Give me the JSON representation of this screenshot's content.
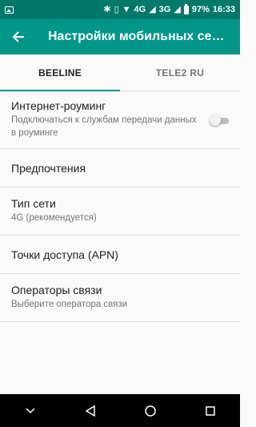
{
  "status_bar": {
    "left_icon": "image-notification-icon",
    "icons": [
      "bluetooth-icon",
      "vibrate-icon",
      "wifi-icon"
    ],
    "network1": "4G",
    "network2": "3G",
    "battery_text": "97%",
    "time": "16:33"
  },
  "app_bar": {
    "back_icon": "arrow-back-icon",
    "title": "Настройки мобильных се…"
  },
  "tabs": [
    {
      "label": "BEELINE",
      "active": true
    },
    {
      "label": "TELE2 RU",
      "active": false
    }
  ],
  "settings": [
    {
      "title": "Интернет-роуминг",
      "summary": "Подключаться к службам передачи данных в роуминге",
      "toggle": false
    },
    {
      "title": "Предпочтения",
      "summary": ""
    },
    {
      "title": "Тип сети",
      "summary": "4G (рекомендуется)"
    },
    {
      "title": "Точки доступа (APN)",
      "summary": ""
    },
    {
      "title": "Операторы связи",
      "summary": "Выберите оператора связи"
    }
  ],
  "nav_bar": {
    "icons": [
      "chevron-down-icon",
      "back-triangle-icon",
      "home-circle-icon",
      "recents-square-icon"
    ]
  },
  "colors": {
    "primary": "#009688",
    "primary_dark": "#00796b"
  }
}
